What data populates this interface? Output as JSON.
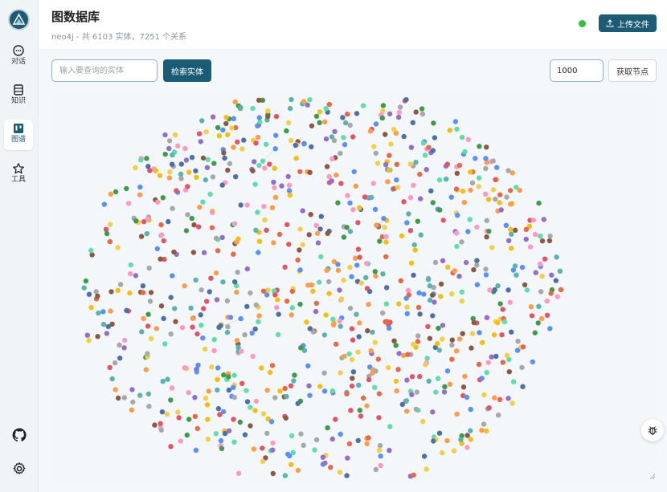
{
  "sidebar": {
    "items": [
      {
        "label": "对话",
        "icon": "chat-bubble-icon"
      },
      {
        "label": "知识",
        "icon": "database-icon"
      },
      {
        "label": "图谱",
        "icon": "kanban-icon"
      },
      {
        "label": "工具",
        "icon": "star-icon"
      }
    ],
    "active_index": 2,
    "bottom_icons": [
      "github-icon",
      "gear-icon"
    ]
  },
  "header": {
    "title": "图数据库",
    "subtitle": "neo4j - 共 6103 实体，7251 个关系",
    "upload_label": "上传文件",
    "status_color": "#3cbc3c"
  },
  "toolbar": {
    "search_placeholder": "输入要查询的实体",
    "search_value": "",
    "search_label": "检索实体",
    "count_value": "1000",
    "fetch_label": "获取节点"
  },
  "graph": {
    "node_colors": [
      "#5b8ff9",
      "#61ddaa",
      "#f6bd16",
      "#e8684a",
      "#9270ca",
      "#ff9d4d",
      "#4f6fa8",
      "#ff99c3",
      "#5ab3ad",
      "#a8a8a8",
      "#3f9b4a",
      "#e05666",
      "#8a5a44",
      "#f2cf4a"
    ],
    "approx_node_count": 1000
  },
  "colors": {
    "accent": "#1b5b74",
    "background": "#f5f8fa"
  }
}
